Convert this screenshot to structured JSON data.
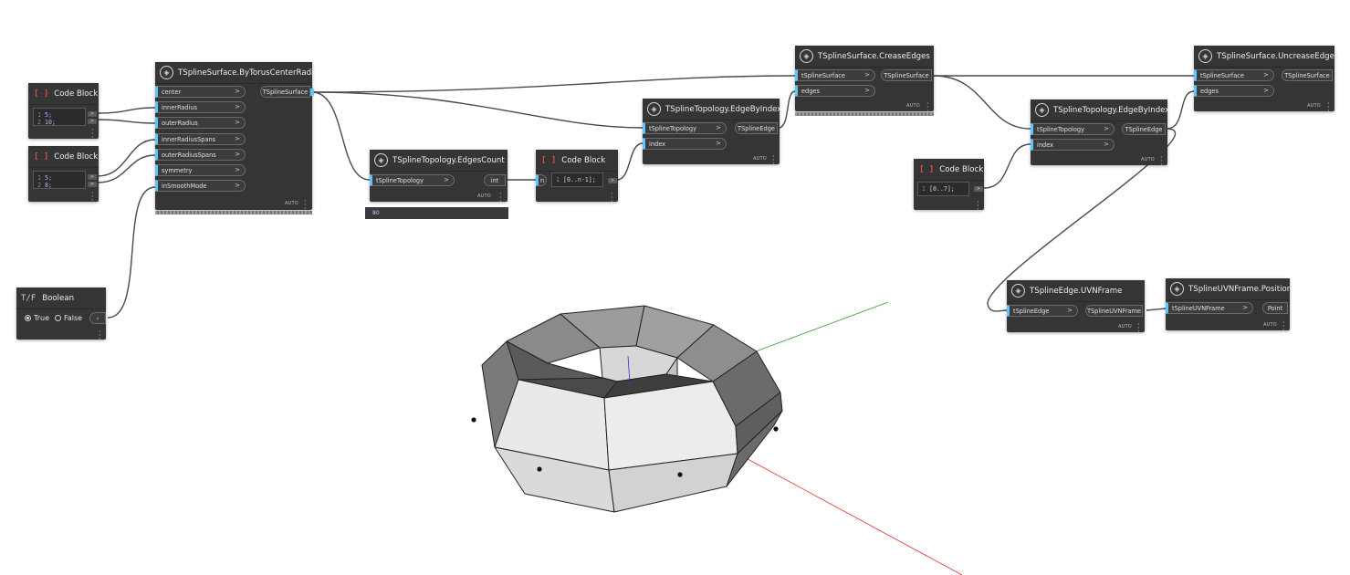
{
  "nodes": {
    "codeblock1": {
      "title": "Code Block",
      "lines": [
        "5;",
        "10;"
      ]
    },
    "codeblock2": {
      "title": "Code Block",
      "lines": [
        "5;",
        "8;"
      ]
    },
    "boolean": {
      "title": "Boolean",
      "true_label": "True",
      "false_label": "False"
    },
    "torus": {
      "title": "TSplineSurface.ByTorusCenterRadii",
      "inputs": [
        "center",
        "innerRadius",
        "outerRadius",
        "innerRadiusSpans",
        "outerRadiusSpans",
        "symmetry",
        "inSmoothMode"
      ],
      "output": "TSplineSurface",
      "lacing": "AUTO"
    },
    "edgescount": {
      "title": "TSplineTopology.EdgesCount",
      "input": "tSplineTopology",
      "output": "int",
      "lacing": "AUTO",
      "preview": "80"
    },
    "codeblock3": {
      "title": "Code Block",
      "input": "n",
      "code": "[0..n-1];"
    },
    "edgebyindex1": {
      "title": "TSplineTopology.EdgeByIndex",
      "inputs": [
        "tSplineTopology",
        "index"
      ],
      "output": "TSplineEdge",
      "lacing": "AUTO"
    },
    "crease": {
      "title": "TSplineSurface.CreaseEdges",
      "inputs": [
        "tSplineSurface",
        "edges"
      ],
      "output": "TSplineSurface",
      "lacing": "AUTO"
    },
    "codeblock4": {
      "title": "Code Block",
      "code": "[0..7];"
    },
    "edgebyindex2": {
      "title": "TSplineTopology.EdgeByIndex",
      "inputs": [
        "tSplineTopology",
        "index"
      ],
      "output": "TSplineEdge",
      "lacing": "AUTO"
    },
    "uncrease": {
      "title": "TSplineSurface.UncreaseEdges",
      "inputs": [
        "tSplineSurface",
        "edges"
      ],
      "output": "TSplineSurface",
      "lacing": "AUTO"
    },
    "uvnframe": {
      "title": "TSplineEdge.UVNFrame",
      "input": "tSplineEdge",
      "output": "TSplineUVNFrame",
      "lacing": "AUTO"
    },
    "position": {
      "title": "TSplineUVNFrame.Position",
      "input": "tSplineUVNFrame",
      "output": "Point",
      "lacing": "AUTO"
    }
  },
  "line_numbers": [
    "1",
    "2"
  ],
  "colors": {
    "port_accent": "#5ec6ff",
    "node_bg": "#353535",
    "wire": "#4a4a4a",
    "axis_x": "#e03030",
    "axis_y": "#3a9a3a",
    "axis_z": "#3030d0"
  }
}
